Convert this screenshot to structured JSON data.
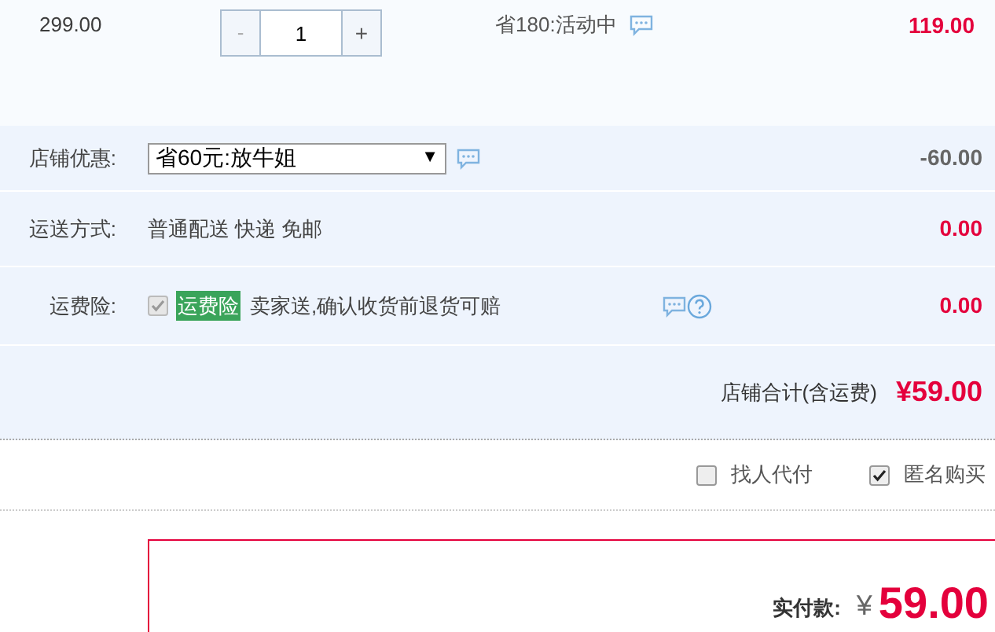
{
  "item": {
    "original_price": "299.00",
    "minus": "-",
    "quantity": "1",
    "plus": "+",
    "promo": "省180:活动中",
    "subtotal": "119.00"
  },
  "rows": [
    {
      "kind": "select",
      "label": "店铺优惠:",
      "value": "省60元:放牛姐",
      "caret": "▼",
      "amount": "-60.00",
      "highlighted": false
    },
    {
      "kind": "text",
      "label": "运送方式:",
      "text": "普通配送 快递 免邮",
      "amount": "0.00",
      "highlighted": true
    },
    {
      "kind": "insurance",
      "label": "运费险:",
      "checked": true,
      "disabled": true,
      "tag": "运费险",
      "text": "卖家送,确认收货前退货可赔",
      "amount": "0.00",
      "highlighted": true
    }
  ],
  "total": {
    "label": "店铺合计(含运费)",
    "amount": "¥59.00"
  },
  "options": [
    {
      "label": "找人代付",
      "checked": false
    },
    {
      "label": "匿名购买",
      "checked": true
    }
  ],
  "payment": {
    "label": "实付款:",
    "currency": "¥",
    "amount": "59.00"
  }
}
